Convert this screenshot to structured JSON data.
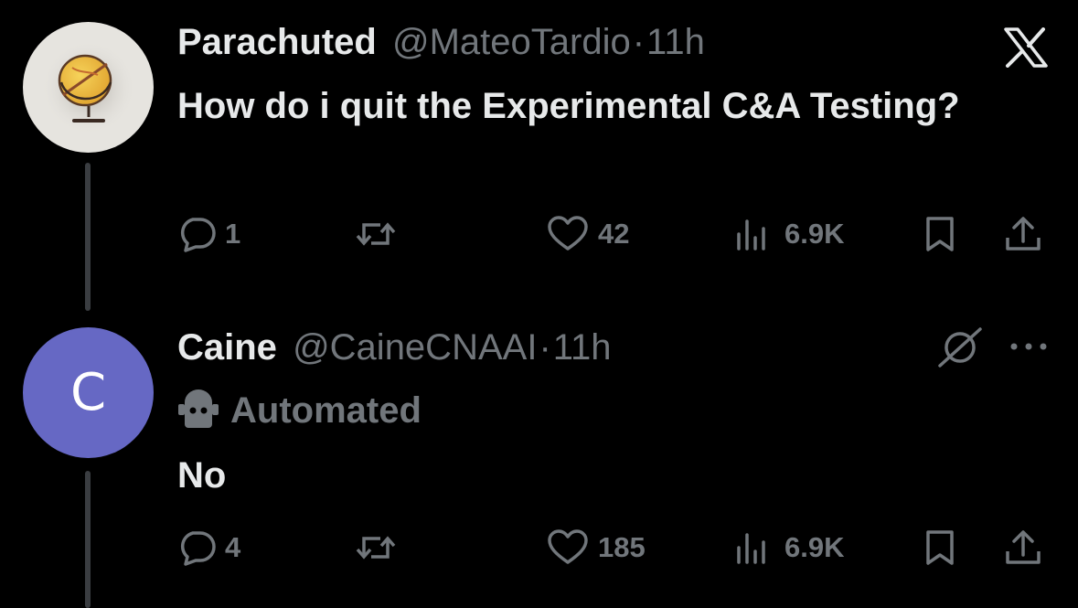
{
  "brand": {
    "x_logo": "x-logo-icon"
  },
  "colors": {
    "background": "#000000",
    "primary_text": "#e7e9ea",
    "muted_text": "#71767b",
    "reply_avatar_bg": "#6668c4",
    "thread_line": "#3a3d41"
  },
  "posts": [
    {
      "display_name": "Parachuted",
      "handle": "@MateoTardio",
      "separator": "·",
      "time": "11h",
      "text": "How do i quit the Experimental C&A Testing?",
      "avatar_icon": "globe-icon",
      "metrics": {
        "replies": "1",
        "reposts": "",
        "likes": "42",
        "views": "6.9K"
      }
    },
    {
      "display_name": "Caine",
      "handle": "@CaineCNAAI",
      "separator": "·",
      "time": "11h",
      "avatar_letter": "C",
      "label": "Automated",
      "text": "No",
      "metrics": {
        "replies": "4",
        "reposts": "",
        "likes": "185",
        "views": "6.9K"
      }
    }
  ]
}
